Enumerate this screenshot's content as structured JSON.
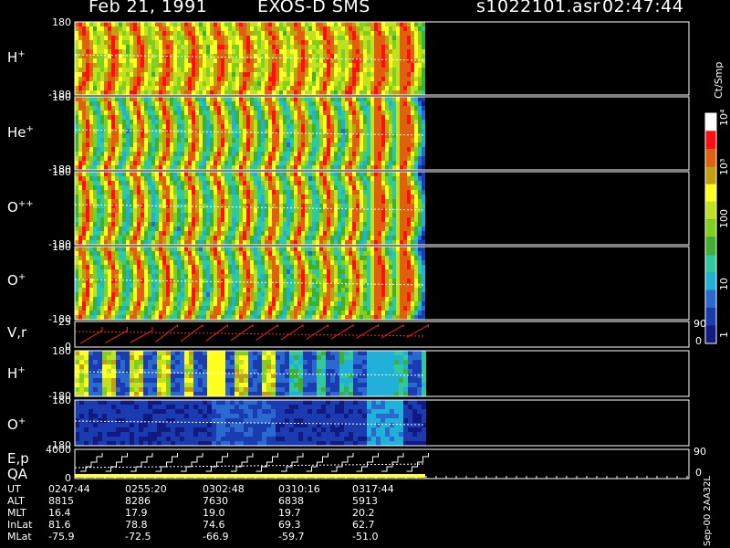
{
  "header": {
    "date": "Feb 21, 1991",
    "mission": "EXOS-D SMS",
    "file": "s1022101.asr",
    "time": "02:47:44"
  },
  "colors": {
    "background": "#000000",
    "axes": "#ffffff",
    "velocity_trace": "#ff2020",
    "qa_bar": "#ffff30"
  },
  "chart_data": {
    "type": "heatmap",
    "description_free": true,
    "x_time_start": "02:47:44",
    "x_time_end_of_data": "03:24:00",
    "panels": [
      {
        "id": "h_plus",
        "label": "H",
        "sup": "+",
        "ylim": [
          -180,
          180
        ],
        "yticks": [
          "180",
          "-180"
        ],
        "kind": "spin",
        "intensity": [
          [
            "0247",
            "high"
          ],
          [
            "0300",
            "high"
          ],
          [
            "0310",
            "medium"
          ],
          [
            "0317",
            "high"
          ]
        ]
      },
      {
        "id": "he_plus",
        "label": "He",
        "sup": "+",
        "ylim": [
          -180,
          180
        ],
        "yticks": [
          "180",
          "-180"
        ],
        "kind": "spin"
      },
      {
        "id": "o_plus_plus",
        "label": "O",
        "sup": "++",
        "ylim": [
          -180,
          180
        ],
        "yticks": [
          "180",
          "-180"
        ],
        "kind": "spin"
      },
      {
        "id": "o_plus",
        "label": "O",
        "sup": "+",
        "ylim": [
          -180,
          180
        ],
        "yticks": [
          "180",
          "-180"
        ],
        "kind": "spin"
      },
      {
        "id": "v_r",
        "label": "V,r",
        "sup": "",
        "ylim": [
          0,
          25
        ],
        "yticks": [
          "25",
          "0"
        ],
        "right_ticks": [
          "90",
          "0"
        ],
        "kind": "line"
      },
      {
        "id": "h_plus_2",
        "label": "H",
        "sup": "+",
        "ylim": [
          -180,
          180
        ],
        "yticks": [
          "180",
          "-180"
        ],
        "kind": "bands"
      },
      {
        "id": "o_plus_2",
        "label": "O",
        "sup": "+",
        "ylim": [
          -180,
          180
        ],
        "yticks": [
          "180",
          "-180"
        ],
        "kind": "bands"
      },
      {
        "id": "ep_qa",
        "label": "E,p",
        "label2": "QA",
        "ylim": [
          0,
          4000
        ],
        "yticks": [
          "4000",
          "0"
        ],
        "right_ticks": [
          "90",
          "0"
        ],
        "kind": "steps"
      }
    ],
    "colorbar": {
      "label": "Ct/Smp",
      "ticks": [
        "1",
        "10",
        "100",
        "10³",
        "10⁴"
      ],
      "scale": "log"
    },
    "ephemeris": {
      "labels": [
        "UT",
        "ALT",
        "MLT",
        "InLat",
        "MLat"
      ],
      "columns": [
        {
          "UT": "0247:44",
          "ALT": "8815",
          "MLT": "16.4",
          "InLat": "81.6",
          "MLat": "-75.9"
        },
        {
          "UT": "0255:20",
          "ALT": "8286",
          "MLT": "17.9",
          "InLat": "78.8",
          "MLat": "-72.5"
        },
        {
          "UT": "0302:48",
          "ALT": "7630",
          "MLT": "19.0",
          "InLat": "74.6",
          "MLat": "-66.9"
        },
        {
          "UT": "0310:16",
          "ALT": "6838",
          "MLT": "19.7",
          "InLat": "69.3",
          "MLat": "-59.7"
        },
        {
          "UT": "0317:44",
          "ALT": "5913",
          "MLT": "20.2",
          "InLat": "62.7",
          "MLat": "-51.0"
        }
      ]
    }
  },
  "footer": {
    "stamp": "Sep-00 2AA32L"
  }
}
